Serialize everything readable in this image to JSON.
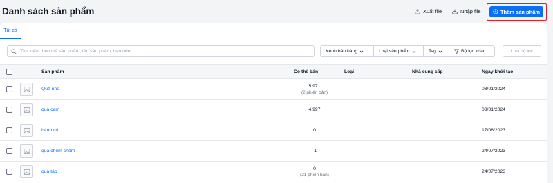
{
  "header": {
    "title": "Danh sách sản phẩm",
    "export_label": "Xuất file",
    "import_label": "Nhập file",
    "add_label": "Thêm sản phẩm"
  },
  "tabs": [
    {
      "label": "Tất cả"
    }
  ],
  "search": {
    "placeholder": "Tìm kiếm theo mã sản phẩm, tên sản phẩm, barcode",
    "value": ""
  },
  "filters": {
    "channel": "Kênh bán hàng",
    "product_type": "Loại sản phẩm",
    "tag": "Tag",
    "other": "Bộ lọc khác",
    "save": "Lưu bộ lọc"
  },
  "table": {
    "columns": {
      "product": "Sản phẩm",
      "stock": "Có thể bán",
      "type": "Loại",
      "supplier": "Nhà cung cấp",
      "created": "Ngày khởi tạo"
    },
    "rows": [
      {
        "name": "Quả nho",
        "stock": "5,971",
        "variants": "(2 phiên bản)",
        "type": "",
        "supplier": "",
        "created": "03/01/2024"
      },
      {
        "name": "quả cam",
        "stock": "4,997",
        "variants": "",
        "type": "",
        "supplier": "",
        "created": "03/01/2024"
      },
      {
        "name": "bánh mì",
        "stock": "0",
        "variants": "",
        "type": "",
        "supplier": "",
        "created": "17/08/2023"
      },
      {
        "name": "quả chôm chôm",
        "stock": "-1",
        "variants": "",
        "type": "",
        "supplier": "",
        "created": "24/07/2023"
      },
      {
        "name": "quả táo",
        "stock": "0",
        "variants": "(21 phiên bản)",
        "type": "",
        "supplier": "",
        "created": "24/07/2023"
      }
    ]
  },
  "icons": {
    "export": "export-icon",
    "import": "import-icon",
    "add": "plus-circle-icon",
    "search": "search-icon",
    "chevron": "chevron-down-icon",
    "filter": "filter-icon",
    "thumbnail": "image-placeholder-icon"
  },
  "colors": {
    "accent": "#0b6ff5",
    "highlight_border": "#e11d2e"
  }
}
